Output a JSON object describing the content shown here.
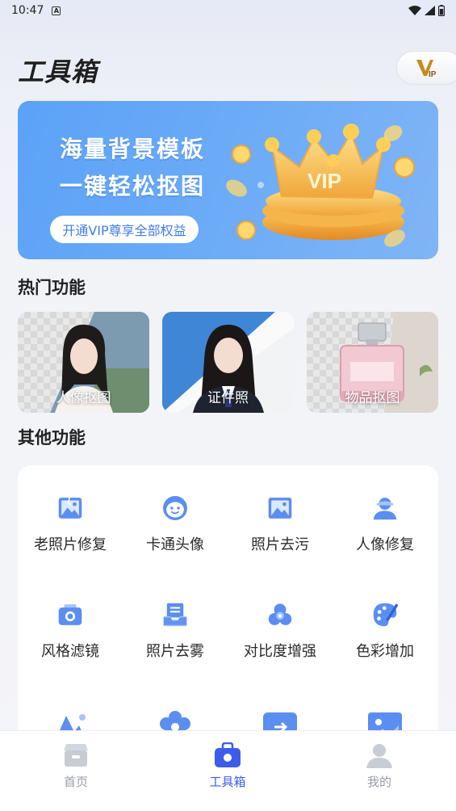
{
  "status_bar": {
    "time": "10:47",
    "notif_letter": "A"
  },
  "header": {
    "title": "工具箱",
    "vip_badge_text": "VIP"
  },
  "banner": {
    "line1": "海量背景模板",
    "line2": "一键轻松抠图",
    "cta_label": "开通VIP尊享全部权益",
    "crown_text": "VIP"
  },
  "hot_section": {
    "title": "热门功能",
    "items": [
      {
        "label": "人像抠图"
      },
      {
        "label": "证件照"
      },
      {
        "label": "物品抠图"
      }
    ]
  },
  "other_section": {
    "title": "其他功能",
    "items": [
      {
        "label": "老照片修复",
        "icon": "old-photo-icon"
      },
      {
        "label": "卡通头像",
        "icon": "cartoon-face-icon"
      },
      {
        "label": "照片去污",
        "icon": "photo-clean-icon"
      },
      {
        "label": "人像修复",
        "icon": "portrait-repair-icon"
      },
      {
        "label": "风格滤镜",
        "icon": "camera-icon"
      },
      {
        "label": "照片去雾",
        "icon": "defog-icon"
      },
      {
        "label": "对比度增强",
        "icon": "contrast-icon"
      },
      {
        "label": "色彩增加",
        "icon": "palette-icon"
      }
    ]
  },
  "tabbar": {
    "items": [
      {
        "label": "首页",
        "icon": "home-icon",
        "active": false
      },
      {
        "label": "工具箱",
        "icon": "toolbox-icon",
        "active": true
      },
      {
        "label": "我的",
        "icon": "user-icon",
        "active": false
      }
    ]
  },
  "colors": {
    "accent": "#3d5ce9",
    "icon_blue": "#5b8ef0",
    "banner_blue": "#5ba2f7"
  }
}
